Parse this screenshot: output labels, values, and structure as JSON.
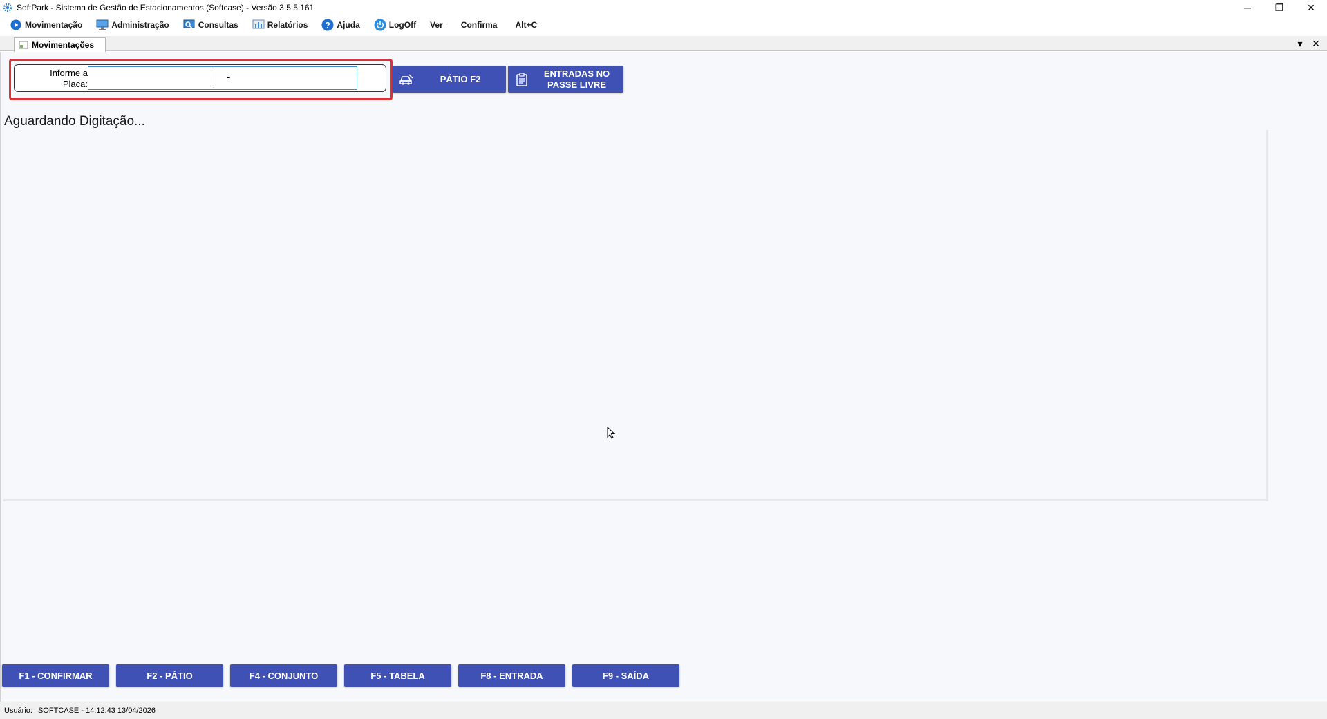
{
  "window": {
    "title": "SoftPark - Sistema de Gestão de Estacionamentos (Softcase) - Versão 3.5.5.161",
    "controls": {
      "minimize": "─",
      "restore": "❐",
      "close": "✕"
    }
  },
  "menu": {
    "items": [
      {
        "label": "Movimentação",
        "icon": "play-circle-icon"
      },
      {
        "label": "Administração",
        "icon": "monitor-icon"
      },
      {
        "label": "Consultas",
        "icon": "search-screen-icon"
      },
      {
        "label": "Relatórios",
        "icon": "report-icon"
      },
      {
        "label": "Ajuda",
        "icon": "help-icon"
      },
      {
        "label": "LogOff",
        "icon": "power-icon"
      }
    ],
    "plain_items": [
      "Ver",
      "Confirma",
      "Alt+C"
    ]
  },
  "tabs": {
    "active": "Movimentações",
    "dropdown_glyph": "▾",
    "close_glyph": "✕"
  },
  "plate": {
    "label": "Informe a Placa:",
    "value": "",
    "separator": "-"
  },
  "buttons": {
    "patio": "PÁTIO F2",
    "entradas": "ENTRADAS NO PASSE LIVRE"
  },
  "status_message": "Aguardando Digitação...",
  "function_keys": [
    "F1 - CONFIRMAR",
    "F2 - PÁTIO",
    "F4 - CONJUNTO",
    "F5 - TABELA",
    "F8 - ENTRADA",
    "F9 - SAÍDA"
  ],
  "statusbar": {
    "label": "Usuário:",
    "value": "SOFTCASE - 14:12:43 13/04/2026"
  },
  "colors": {
    "accent": "#3f51b5",
    "highlight": "#e0313b",
    "input_border": "#3e89d6"
  }
}
